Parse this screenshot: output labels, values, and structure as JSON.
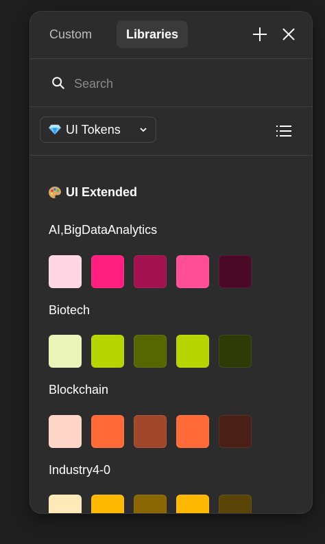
{
  "tabs": {
    "custom": "Custom",
    "libraries": "Libraries"
  },
  "search": {
    "placeholder": "Search"
  },
  "library_select": {
    "label": "UI Tokens"
  },
  "section": {
    "title": "UI Extended"
  },
  "groups": [
    {
      "label": "AI,BigDataAnalytics",
      "swatches": [
        "#ffd6e4",
        "#ff1f7f",
        "#a3124f",
        "#ff4d96",
        "#4a0a26"
      ]
    },
    {
      "label": "Biotech",
      "swatches": [
        "#eaf4b8",
        "#b5d400",
        "#566600",
        "#b5d400",
        "#2f3a06"
      ]
    },
    {
      "label": "Blockchain",
      "swatches": [
        "#ffd5c9",
        "#ff6a38",
        "#a2482a",
        "#ff6a38",
        "#4a1f16"
      ]
    },
    {
      "label": "Industry4-0",
      "swatches": [
        "#ffe9b8",
        "#ffb800",
        "#8a6600",
        "#ffb800",
        "#5a4408"
      ]
    }
  ],
  "colors": {
    "panel_bg": "#2c2c2c",
    "page_bg": "#1e1e1e",
    "tab_active_bg": "#3a3a3a",
    "divider": "#404040"
  }
}
